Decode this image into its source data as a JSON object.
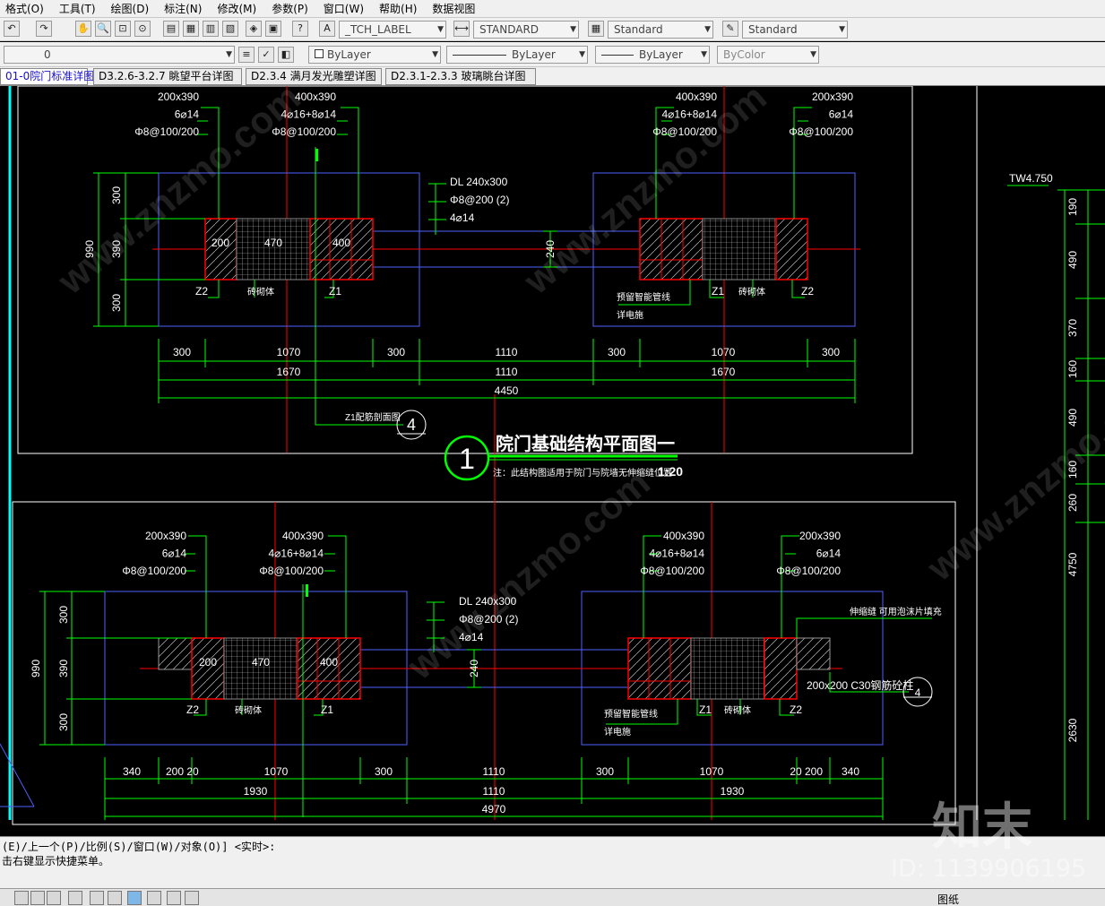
{
  "menu": [
    "格式(O)",
    "工具(T)",
    "绘图(D)",
    "标注(N)",
    "修改(M)",
    "参数(P)",
    "窗口(W)",
    "帮助(H)",
    "数据视图"
  ],
  "toolbar1": {
    "text_style": "_TCH_LABEL",
    "dim_style": "STANDARD",
    "table_style": "Standard",
    "multileader_style": "Standard"
  },
  "toolbar2": {
    "layer": "0",
    "color": "ByLayer",
    "linetype": "ByLayer",
    "lineweight": "ByLayer",
    "plot_style": "ByColor"
  },
  "tabs": [
    "01-0院门标准详图",
    "D3.2.6-3.2.7 眺望平台详图",
    "D2.3.4 满月发光雕塑详图",
    "D2.3.1-2.3.3 玻璃眺台详图"
  ],
  "drawing": {
    "title": "院门基础结构平面图一",
    "title_number": "1",
    "note": "注：此结构图适用于院门与院墙无伸缩缝位置",
    "scale": "1:20",
    "section_ref": "Z1配筋剖面图",
    "section_number": "4",
    "elev_top": "TW4.750",
    "elev_dims": [
      "190",
      "490",
      "370",
      "160",
      "490",
      "160",
      "260",
      "4750",
      "2630"
    ],
    "top": {
      "labels_left": [
        "200x390",
        "6⌀14",
        "Φ8@100/200"
      ],
      "labels_mid_left": [
        "400x390",
        "4⌀16+8⌀14",
        "Φ8@100/200"
      ],
      "labels_mid_right": [
        "400x390",
        "4⌀16+8⌀14",
        "Φ8@100/200"
      ],
      "labels_right": [
        "200x390",
        "6⌀14",
        "Φ8@100/200"
      ],
      "beam": [
        "DL 240x300",
        "Φ8@200 (2)",
        "4⌀14"
      ],
      "col_dims": [
        "200",
        "470",
        "400"
      ],
      "side_dims": [
        "300",
        "390",
        "300",
        "990"
      ],
      "beam_dim": "240",
      "tags": [
        "Z2",
        "砖砌体",
        "Z1",
        "Z1",
        "砖砌体",
        "Z2"
      ],
      "pipe_note": [
        "预留智能管线",
        "详电施"
      ],
      "dims_row1": [
        "300",
        "1070",
        "300",
        "1110",
        "300",
        "1070",
        "300"
      ],
      "dims_row2": [
        "1670",
        "1110",
        "1670"
      ],
      "dims_row3": [
        "4450"
      ]
    },
    "bottom": {
      "labels_left": [
        "200x390",
        "6⌀14",
        "Φ8@100/200"
      ],
      "labels_mid_left": [
        "400x390",
        "4⌀16+8⌀14",
        "Φ8@100/200"
      ],
      "labels_mid_right": [
        "400x390",
        "4⌀16+8⌀14",
        "Φ8@100/200"
      ],
      "labels_right": [
        "200x390",
        "6⌀14",
        "Φ8@100/200"
      ],
      "beam": [
        "DL 240x300",
        "Φ8@200 (2)",
        "4⌀14"
      ],
      "col_dims": [
        "200",
        "470",
        "400"
      ],
      "side_dims": [
        "300",
        "390",
        "300",
        "990"
      ],
      "beam_dim": "240",
      "tags": [
        "Z2",
        "砖砌体",
        "Z1",
        "Z1",
        "砖砌体",
        "Z2"
      ],
      "pipe_note": [
        "预留智能管线",
        "详电施"
      ],
      "joint_note": "伸缩缝  可用泡沫片填充",
      "post_note": "200x200 C30钢筋砼柱",
      "dims_row1": [
        "340",
        "200",
        "20",
        "1070",
        "300",
        "1110",
        "300",
        "1070",
        "20",
        "200",
        "340"
      ],
      "dims_row2": [
        "1930",
        "1110",
        "1930"
      ],
      "dims_row3": [
        "4970"
      ]
    }
  },
  "command": {
    "line1": "(E)/上一个(P)/比例(S)/窗口(W)/对象(O)] <实时>:",
    "line2": "击右键显示快捷菜单。"
  },
  "status": {
    "layout": "图纸"
  },
  "watermark": {
    "brand": "知末",
    "id": "ID: 1139906195",
    "site": "www.znzmo.com"
  },
  "colors": {
    "green": "#00ff00",
    "red": "#ff0000",
    "blue": "#5060ff",
    "white": "#ffffff",
    "cyan": "#00ffff"
  }
}
